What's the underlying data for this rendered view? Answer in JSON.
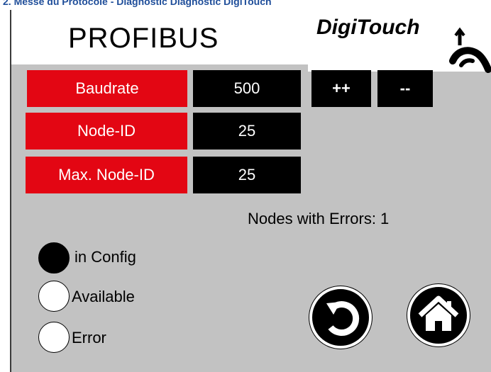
{
  "document_header": "2. Messe du Protocole - Diagnostic Diagnostic DigiTouch",
  "screen": {
    "title": "PROFIBUS",
    "logo_text": "DigiTouch"
  },
  "parameters": {
    "baudrate": {
      "label": "Baudrate",
      "value": "500"
    },
    "node_id": {
      "label": "Node-ID",
      "value": "25"
    },
    "max_node_id": {
      "label": "Max. Node-ID",
      "value": "25"
    }
  },
  "buttons": {
    "increment_label": "++",
    "decrement_label": "--"
  },
  "status": {
    "nodes_with_errors": "Nodes with Errors: 1"
  },
  "legend": [
    {
      "label": "in Config",
      "state": "filled",
      "color": "#000000"
    },
    {
      "label": "Available",
      "state": "empty",
      "color": "#ffffff"
    },
    {
      "label": "Error",
      "state": "empty",
      "color": "#ffffff"
    }
  ],
  "navigation": {
    "back_icon": "rotate-back-icon",
    "home_icon": "home-icon"
  },
  "colors": {
    "label_red": "#e30613",
    "value_black": "#000000",
    "panel_gray": "#c2c2c2",
    "header_blue": "#1f4e9a"
  }
}
